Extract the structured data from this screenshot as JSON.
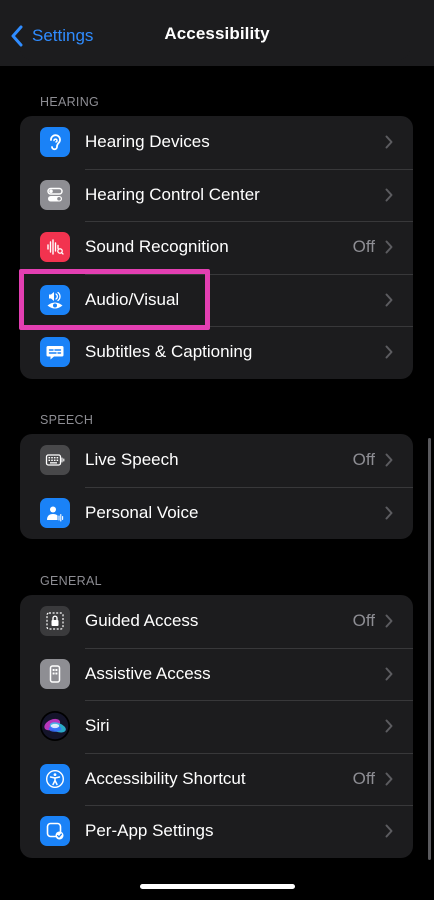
{
  "nav": {
    "back_label": "Settings",
    "title": "Accessibility"
  },
  "colors": {
    "accent": "#2f8cff",
    "highlight": "#e33fb2",
    "background": "#000000",
    "group_background": "#1c1c1e"
  },
  "sections": {
    "hearing": {
      "header": "HEARING",
      "rows": [
        {
          "label": "Hearing Devices",
          "value": "",
          "icon": "ear-icon"
        },
        {
          "label": "Hearing Control Center",
          "value": "",
          "icon": "toggle-icon"
        },
        {
          "label": "Sound Recognition",
          "value": "Off",
          "icon": "waveform-icon"
        },
        {
          "label": "Audio/Visual",
          "value": "",
          "icon": "speaker-eye-icon"
        },
        {
          "label": "Subtitles & Captioning",
          "value": "",
          "icon": "captions-icon"
        }
      ]
    },
    "speech": {
      "header": "SPEECH",
      "rows": [
        {
          "label": "Live Speech",
          "value": "Off",
          "icon": "keyboard-icon"
        },
        {
          "label": "Personal Voice",
          "value": "",
          "icon": "person-wave-icon"
        }
      ]
    },
    "general": {
      "header": "GENERAL",
      "rows": [
        {
          "label": "Guided Access",
          "value": "Off",
          "icon": "lock-icon"
        },
        {
          "label": "Assistive Access",
          "value": "",
          "icon": "phone-grid-icon"
        },
        {
          "label": "Siri",
          "value": "",
          "icon": "siri-icon"
        },
        {
          "label": "Accessibility Shortcut",
          "value": "Off",
          "icon": "accessibility-icon"
        },
        {
          "label": "Per-App Settings",
          "value": "",
          "icon": "app-check-icon"
        }
      ]
    }
  }
}
